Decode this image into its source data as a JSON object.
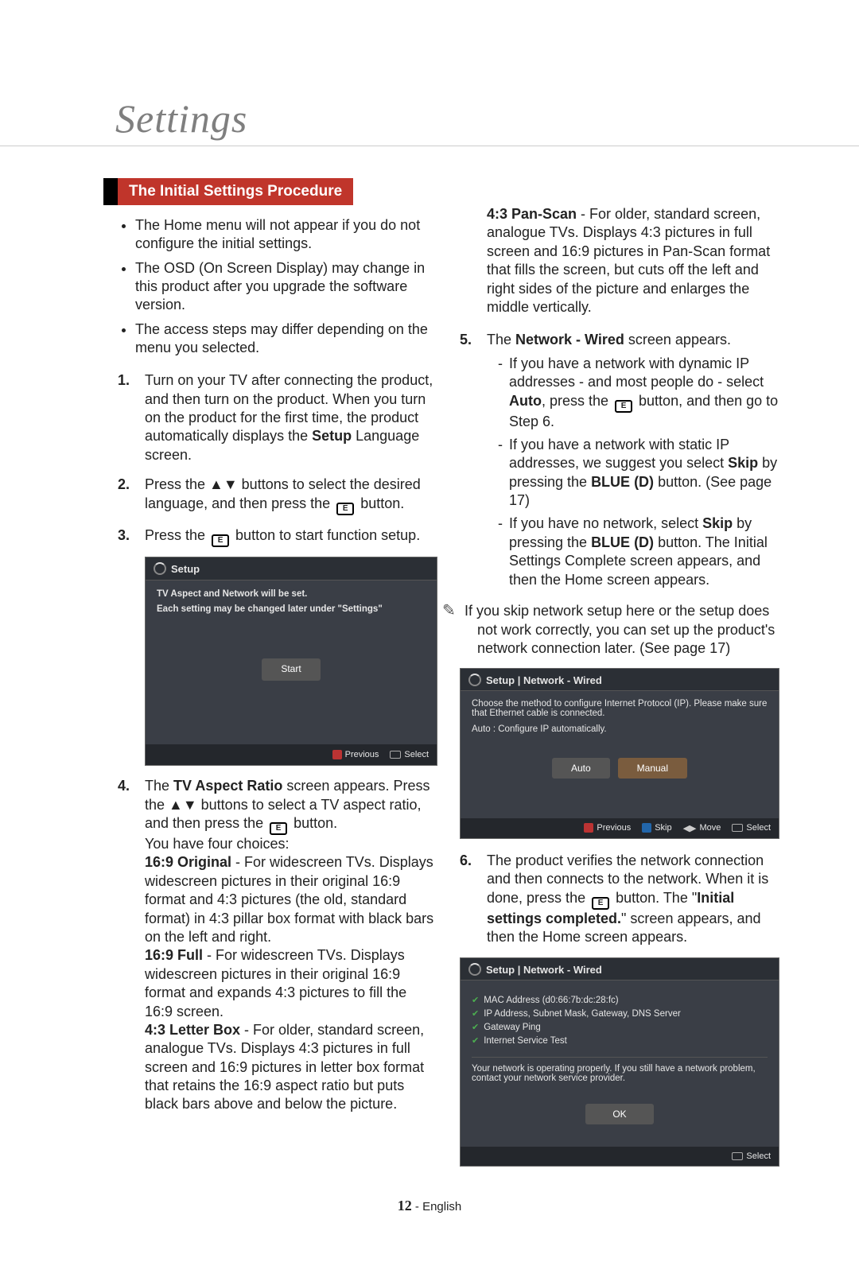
{
  "header": {
    "title": "Settings"
  },
  "section": {
    "title": "The Initial Settings Procedure"
  },
  "notes": {
    "n1": "The Home menu will not appear if you do not configure the initial settings.",
    "n2": "The OSD (On Screen Display) may change in this product after you upgrade the software version.",
    "n3": "The access steps may differ depending on the menu you selected."
  },
  "left": {
    "s1_a": "Turn on your TV after connecting the product, and then turn on the product. When you turn on the product for the first time, the product automatically displays the ",
    "s1_b": "Setup",
    "s1_c": " Language screen.",
    "s2_a": "Press the ▲▼ buttons to select the desired language, and then press the ",
    "s2_b": " button.",
    "s3_a": "Press the ",
    "s3_b": " button to start function setup.",
    "s4_a": "The ",
    "s4_b": "TV Aspect Ratio",
    "s4_c": " screen appears. Press the ▲▼ buttons to select a TV aspect ratio, and then press the ",
    "s4_d": " button.",
    "s4_choices": "You have four choices:",
    "opt1_t": "16:9 Original",
    "opt1_d": " - For widescreen TVs. Displays widescreen pictures in their original 16:9 format and 4:3 pictures (the old, standard format) in 4:3 pillar box format with black bars on the left and right.",
    "opt2_t": "16:9 Full",
    "opt2_d": " - For widescreen TVs. Displays widescreen pictures in their original 16:9 format and expands 4:3 pictures to fill the 16:9 screen.",
    "opt3_t": "4:3 Letter Box",
    "opt3_d": " - For older, standard screen, analogue TVs. Displays 4:3 pictures in full screen and 16:9 pictures in letter box format that retains the 16:9 aspect ratio but puts black bars above and below the picture."
  },
  "right": {
    "opt4_t": "4:3 Pan-Scan",
    "opt4_d": " - For older, standard screen, analogue TVs. Displays 4:3 pictures in full screen and 16:9 pictures in Pan-Scan format that fills the screen, but cuts off the left and right sides of the picture and enlarges the middle vertically.",
    "s5_a": "The ",
    "s5_b": "Network - Wired",
    "s5_c": " screen appears.",
    "s5_sub1_a": "If you have a network with dynamic IP addresses - and most people do - select ",
    "s5_sub1_b": "Auto",
    "s5_sub1_c": ", press the ",
    "s5_sub1_d": " button, and then go to Step 6.",
    "s5_sub2_a": "If you have a network with static IP addresses, we suggest you select ",
    "s5_sub2_b": "Skip",
    "s5_sub2_c": " by pressing the ",
    "s5_sub2_d": "BLUE (D)",
    "s5_sub2_e": " button. (See page 17)",
    "s5_sub3_a": "If you have no network, select ",
    "s5_sub3_b": "Skip",
    "s5_sub3_c": " by pressing the ",
    "s5_sub3_d": "BLUE (D)",
    "s5_sub3_e": " button. The Initial Settings Complete screen appears, and then the Home screen appears.",
    "note_a": "If you skip network setup here or the setup does not work correctly, you can set up the product's network connection later. (See page 17)",
    "s6_a": "The product verifies the network connection and then connects to the network. When it is done, press the ",
    "s6_b": " button. The \"",
    "s6_c": "Initial settings completed.",
    "s6_d": "\" screen appears, and then the Home screen appears."
  },
  "osd1": {
    "title": "Setup",
    "line1": "TV Aspect and Network will be set.",
    "line2": "Each setting may be changed later under \"Settings\"",
    "start": "Start",
    "prev": "Previous",
    "sel": "Select"
  },
  "osd2": {
    "title": "Setup | Network - Wired",
    "msg": "Choose the method to configure Internet Protocol (IP). Please make sure that Ethernet cable is connected.",
    "auto_desc": "Auto : Configure IP automatically.",
    "auto": "Auto",
    "manual": "Manual",
    "prev": "Previous",
    "skip": "Skip",
    "move": "Move",
    "sel": "Select"
  },
  "osd3": {
    "title": "Setup | Network - Wired",
    "c1": "MAC Address (d0:66:7b:dc:28:fc)",
    "c2": "IP Address, Subnet Mask, Gateway, DNS Server",
    "c3": "Gateway Ping",
    "c4": "Internet Service Test",
    "msg": "Your network is operating properly. If you still have a network problem, contact your network service provider.",
    "ok": "OK",
    "sel": "Select"
  },
  "foot": {
    "num": "12",
    "lang": " - English"
  }
}
